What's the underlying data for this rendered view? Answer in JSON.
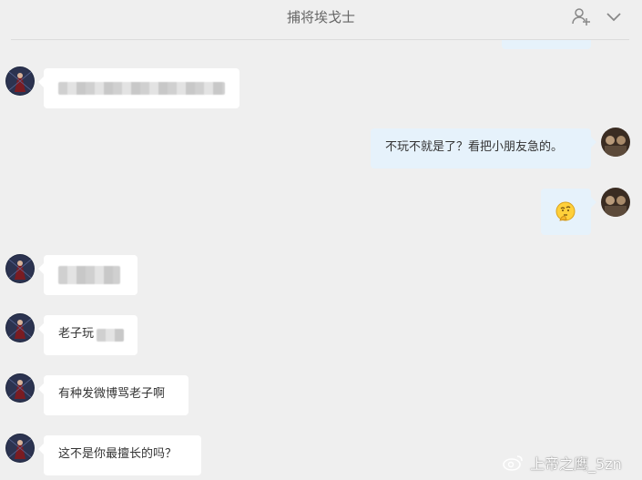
{
  "header": {
    "title": "捕将埃戈士",
    "add_member_icon": "add-member-icon",
    "chevron_icon": "chevron-down-icon"
  },
  "messages": [
    {
      "side": "in",
      "text": "",
      "blurred": true
    },
    {
      "side": "out",
      "text": "不玩不就是了？看把小朋友急的。"
    },
    {
      "side": "out",
      "text": "",
      "emoji": "thinking-emoji"
    },
    {
      "side": "in",
      "text": "",
      "blurred": true
    },
    {
      "side": "in",
      "text": "老子玩"
    },
    {
      "side": "in",
      "text": "有种发微博骂老子啊"
    },
    {
      "side": "in",
      "text": "这不是你最擅长的吗？"
    }
  ],
  "watermark": {
    "text": "上帝之鹰_5zn",
    "icon": "weibo-icon"
  },
  "colors": {
    "background": "#efefef",
    "incoming_bubble": "#ffffff",
    "outgoing_bubble": "#e6f2fb"
  }
}
